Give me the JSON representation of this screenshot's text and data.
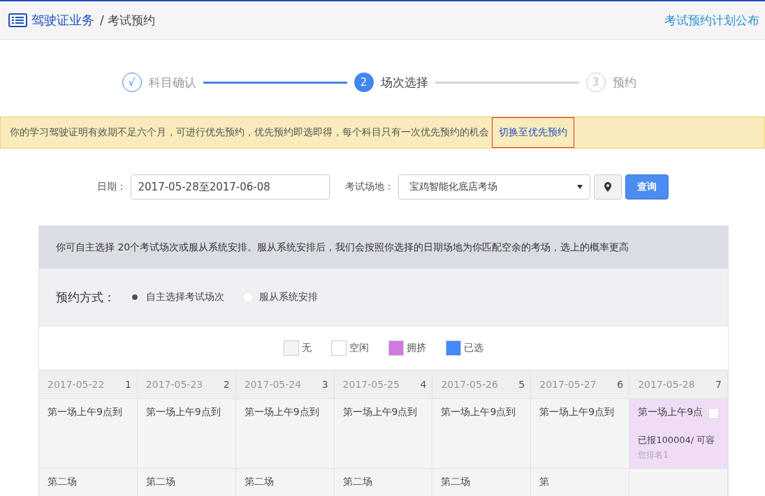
{
  "header": {
    "section": "驾驶证业务",
    "page": "/ 考试预约",
    "link": "考试预约计划公布"
  },
  "steps": [
    {
      "number": "√",
      "label": "科目确认",
      "done": true,
      "selected": false
    },
    {
      "number": "2",
      "label": "场次选择",
      "done": false,
      "selected": true
    },
    {
      "number": "3",
      "label": "预约",
      "done": false,
      "selected": false
    }
  ],
  "notice": {
    "text": "你的学习驾驶证明有效期不足六个月，可进行优先预约，优先预约即选即得，每个科目只有一次优先预约的机会",
    "link": "切换至优先预约"
  },
  "filters": {
    "date_label": "日期：",
    "date_value": "2017-05-28至2017-06-08",
    "venue_label": "考试场地：",
    "venue_value": "宝鸡智能化底店考场",
    "search_button": "查询"
  },
  "info": "你可自主选择 20个考试场次或服从系统安排。服从系统安排后，我们会按照你选择的日期场地为你匹配空余的考场，选上的概率更高",
  "mode": {
    "label": "预约方式：",
    "options": [
      {
        "label": "自主选择考试场次",
        "selected": true
      },
      {
        "label": "服从系统安排",
        "selected": false
      }
    ]
  },
  "legend": [
    {
      "label": "无",
      "color": "#f4f4f4"
    },
    {
      "label": "空闲",
      "color": "#ffffff"
    },
    {
      "label": "拥挤",
      "color": "#cf7ae0"
    },
    {
      "label": "已选",
      "color": "#4488ff"
    }
  ],
  "table": {
    "columns": [
      {
        "date": "2017-05-22",
        "index": "1"
      },
      {
        "date": "2017-05-23",
        "index": "2"
      },
      {
        "date": "2017-05-24",
        "index": "3"
      },
      {
        "date": "2017-05-25",
        "index": "4"
      },
      {
        "date": "2017-05-26",
        "index": "5"
      },
      {
        "date": "2017-05-27",
        "index": "6"
      },
      {
        "date": "2017-05-28",
        "index": "7"
      }
    ],
    "rows": [
      {
        "cells": [
          {
            "kind": "none",
            "title": "第一场上午9点到"
          },
          {
            "kind": "none",
            "title": "第一场上午9点到"
          },
          {
            "kind": "none",
            "title": "第一场上午9点到"
          },
          {
            "kind": "none",
            "title": "第一场上午9点到"
          },
          {
            "kind": "none",
            "title": "第一场上午9点到"
          },
          {
            "kind": "none",
            "title": "第一场上午9点到"
          },
          {
            "kind": "crowded",
            "title": "第一场上午9点",
            "checked": false,
            "count": "已报100004/ 可容",
            "rank": "您排名1"
          }
        ]
      },
      {
        "cells": [
          {
            "kind": "none",
            "title": "第二场"
          },
          {
            "kind": "none",
            "title": "第二场"
          },
          {
            "kind": "none",
            "title": "第二场"
          },
          {
            "kind": "none",
            "title": "第二场"
          },
          {
            "kind": "none",
            "title": "第二场"
          },
          {
            "kind": "none",
            "title": "第"
          },
          {
            "kind": "none"
          }
        ]
      }
    ]
  }
}
